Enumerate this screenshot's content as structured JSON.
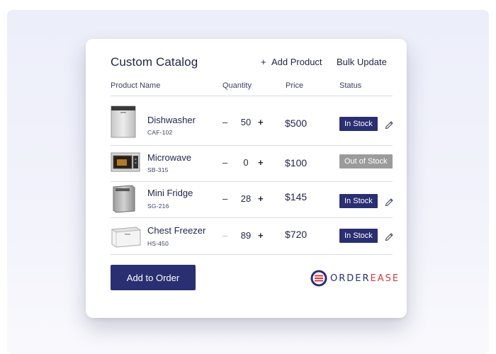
{
  "catalog": {
    "title": "Custom Catalog",
    "add_product_label": "Add Product",
    "bulk_update_label": "Bulk Update"
  },
  "columns": {
    "name": "Product Name",
    "quantity": "Quantity",
    "price": "Price",
    "status": "Status"
  },
  "products": [
    {
      "name": "Dishwasher",
      "sku": "CAF-102",
      "quantity": "50",
      "price": "$500",
      "status": "In Stock",
      "in_stock": true,
      "minus_enabled": true,
      "editable": true,
      "image_icon": "dishwasher-icon"
    },
    {
      "name": "Microwave",
      "sku": "SB-315",
      "quantity": "0",
      "price": "$100",
      "status": "Out of Stock",
      "in_stock": false,
      "minus_enabled": true,
      "editable": false,
      "image_icon": "microwave-icon"
    },
    {
      "name": "Mini Fridge",
      "sku": "SG-216",
      "quantity": "28",
      "price": "$145",
      "status": "In Stock",
      "in_stock": true,
      "minus_enabled": true,
      "editable": true,
      "image_icon": "mini-fridge-icon"
    },
    {
      "name": "Chest Freezer",
      "sku": "HS-450",
      "quantity": "89",
      "price": "$720",
      "status": "In Stock",
      "in_stock": true,
      "minus_enabled": false,
      "editable": true,
      "image_icon": "chest-freezer-icon"
    }
  ],
  "actions": {
    "add_to_order_label": "Add to Order"
  },
  "brand": {
    "logo_part1": "ORDER",
    "logo_part2": "EASE",
    "primary_color": "#2a2f72",
    "accent_color": "#d23a45",
    "out_of_stock_color": "#9b9b9b"
  }
}
